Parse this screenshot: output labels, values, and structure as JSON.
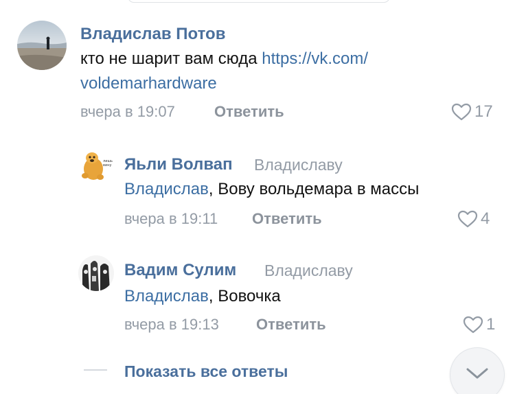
{
  "comments": [
    {
      "author": "Владислав Потов",
      "text_prefix": "кто не шарит вам сюда ",
      "link_line1": "https://vk.com/",
      "link_line2": "voldemarhardware",
      "time": "вчера в 19:07",
      "reply_label": "Ответить",
      "likes": "17"
    }
  ],
  "replies": [
    {
      "author": "Яьли Волвап",
      "reply_to": "Владиславу",
      "mention": "Владислав",
      "text": ", Вову вольдемара в массы",
      "time": "вчера в 19:11",
      "reply_label": "Ответить",
      "likes": "4"
    },
    {
      "author": "Вадим Сулим",
      "reply_to": "Владиславу",
      "mention": "Владислав",
      "text": ", Вовочка",
      "time": "вчера в 19:13",
      "reply_label": "Ответить",
      "likes": "1"
    }
  ],
  "show_all_label": "Показать все ответы",
  "colors": {
    "author": "#4a6f9c",
    "link": "#3c6ea3",
    "meta": "#939ba5"
  },
  "icons": [
    "heart-icon",
    "chevron-down-icon"
  ]
}
